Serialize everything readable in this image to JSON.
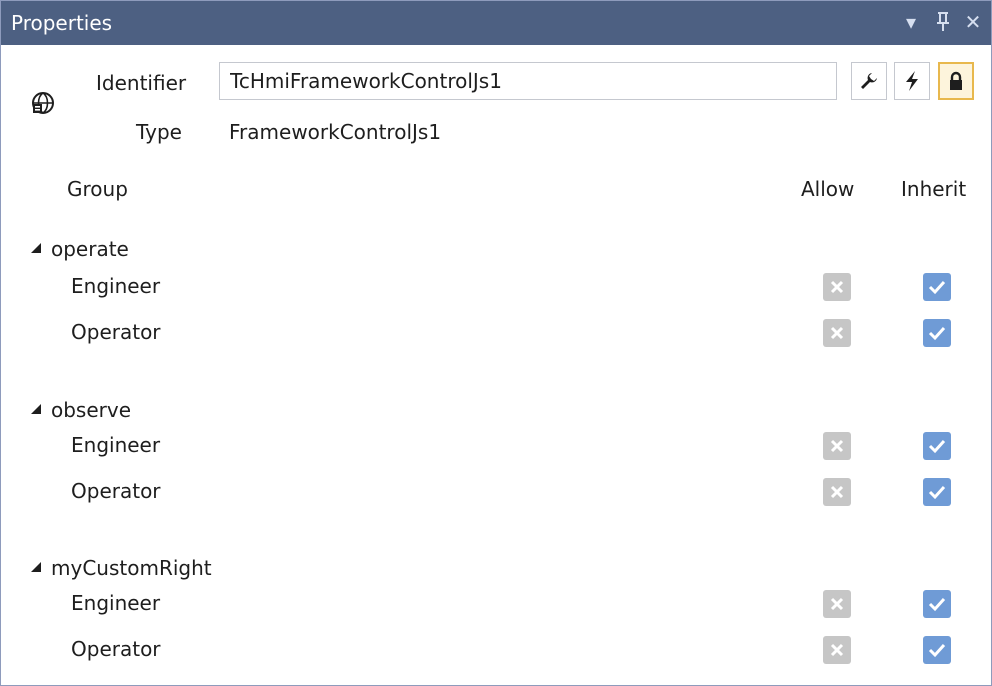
{
  "panel": {
    "title": "Properties",
    "buttons": {
      "dropdown": "▾",
      "pin": "ᛨ",
      "close": "✕"
    }
  },
  "identifier": {
    "label": "Identifier",
    "value": "TcHmiFrameworkControlJs1"
  },
  "type": {
    "label": "Type",
    "value": "FrameworkControlJs1"
  },
  "toolbar": {
    "buttons": [
      {
        "icon": "wrench-icon"
      },
      {
        "icon": "lightning-icon"
      },
      {
        "icon": "lock-icon",
        "active": true
      }
    ]
  },
  "columns": {
    "group": "Group",
    "allow": "Allow",
    "inherit": "Inherit"
  },
  "groups": [
    {
      "name": "operate",
      "members": [
        {
          "name": "Engineer",
          "allow": "denied",
          "inherit": true
        },
        {
          "name": "Operator",
          "allow": "denied",
          "inherit": true
        }
      ]
    },
    {
      "name": "observe",
      "members": [
        {
          "name": "Engineer",
          "allow": "denied",
          "inherit": true
        },
        {
          "name": "Operator",
          "allow": "denied",
          "inherit": true
        }
      ]
    },
    {
      "name": "myCustomRight",
      "members": [
        {
          "name": "Engineer",
          "allow": "denied",
          "inherit": true
        },
        {
          "name": "Operator",
          "allow": "denied",
          "inherit": true
        }
      ]
    }
  ],
  "colors": {
    "titlebar": "#4d6082",
    "allow_disabled": "#c6c6c6",
    "inherit_checked": "#6f9bd6",
    "lock_active_border": "#e8b84d"
  }
}
